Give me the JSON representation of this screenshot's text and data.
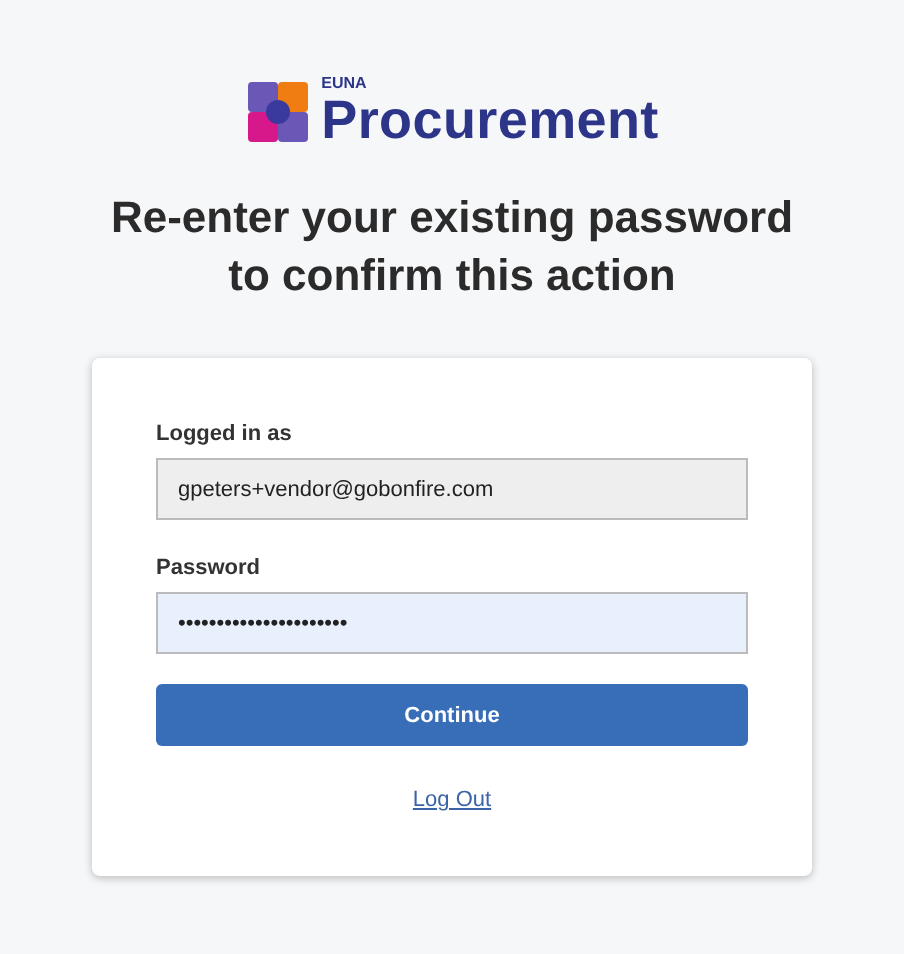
{
  "logo": {
    "small_text": "EUNA",
    "large_text": "Procurement"
  },
  "heading": "Re-enter your existing password to confirm this action",
  "form": {
    "user_label": "Logged in as",
    "user_value": "gpeters+vendor@gobonfire.com",
    "password_label": "Password",
    "password_value": "••••••••••••••••••••••",
    "submit": "Continue",
    "logout": "Log Out"
  }
}
